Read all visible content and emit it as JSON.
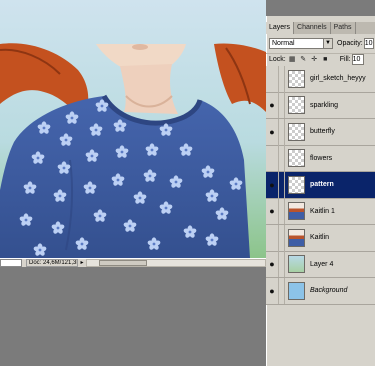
{
  "statusbar": {
    "zoom": "",
    "doc_info": "Doc: 24,6M/121,3M"
  },
  "panel": {
    "tabs": [
      "Layers",
      "Channels",
      "Paths"
    ],
    "blend_mode": "Normal",
    "opacity_label": "Opacity:",
    "opacity_value": "10",
    "lock_label": "Lock:",
    "fill_label": "Fill:",
    "fill_value": "10",
    "layers": [
      {
        "name": "girl_sketch_heyyy",
        "visible": false,
        "selected": false
      },
      {
        "name": "sparkling",
        "visible": true,
        "selected": false
      },
      {
        "name": "butterfly",
        "visible": true,
        "selected": false
      },
      {
        "name": "flowers",
        "visible": false,
        "selected": false
      },
      {
        "name": "pattern",
        "visible": true,
        "selected": true
      },
      {
        "name": "Kaitlin 1",
        "visible": true,
        "selected": false
      },
      {
        "name": "Kaitlin",
        "visible": false,
        "selected": false
      },
      {
        "name": "Layer 4",
        "visible": true,
        "selected": false
      },
      {
        "name": "Background",
        "visible": true,
        "selected": false
      }
    ]
  },
  "colors": {
    "selected_row": "#0a246a",
    "sweater": "#3f5ea6",
    "hair": "#c8501e",
    "skin": "#f1d9c6"
  }
}
